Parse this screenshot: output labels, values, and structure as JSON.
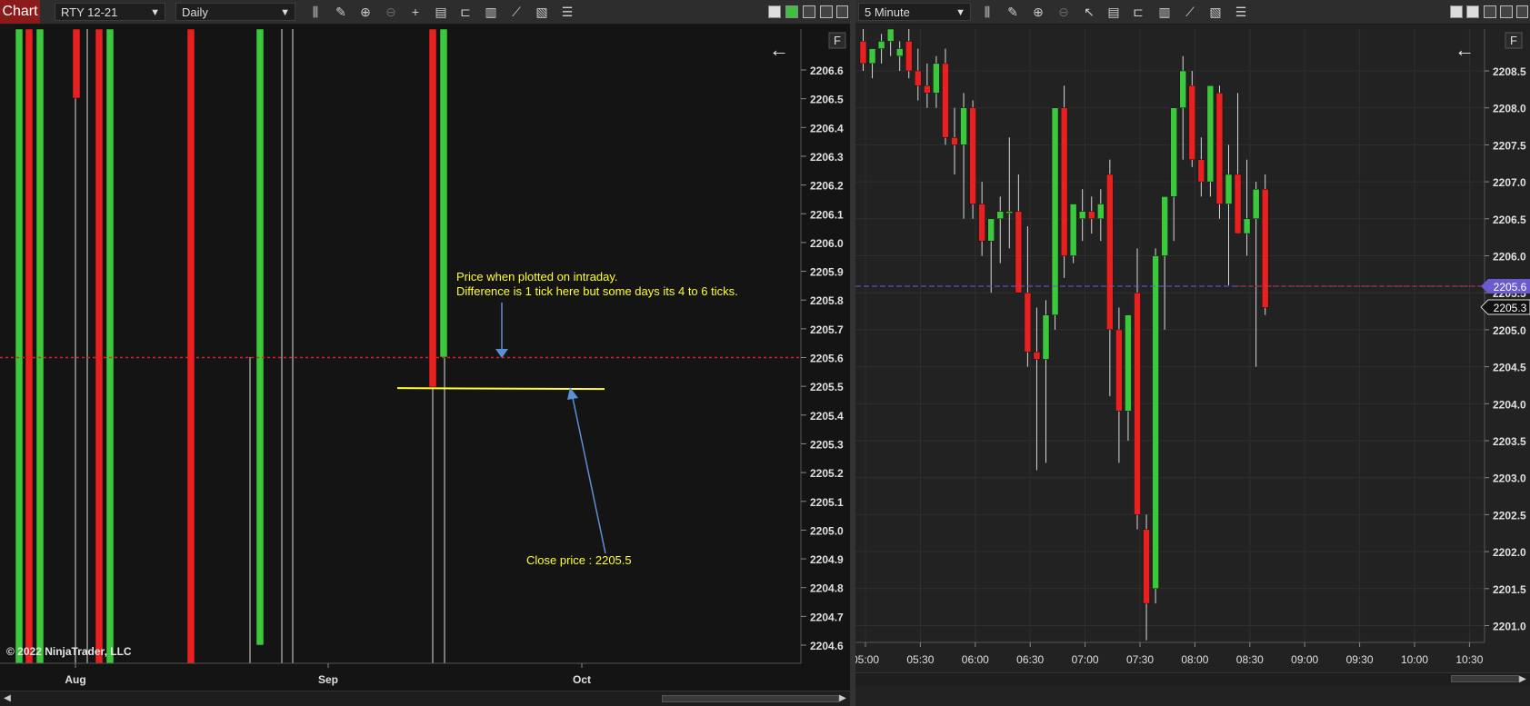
{
  "left": {
    "badge": "Chart",
    "instrument": "RTY 12-21",
    "interval": "Daily",
    "f_label": "F",
    "copyright": "© 2022 NinjaTrader, LLC",
    "annotation_line1": "Price when plotted on intraday.",
    "annotation_line2": "Difference is 1 tick here but some days its 4 to 6 ticks.",
    "close_label": "Close price : 2205.5",
    "y_ticks": [
      "2206.6",
      "2206.5",
      "2206.4",
      "2206.3",
      "2206.2",
      "2206.1",
      "2206.0",
      "2205.9",
      "2205.8",
      "2205.7",
      "2205.6",
      "2205.5",
      "2205.4",
      "2205.3",
      "2205.2",
      "2205.1",
      "2205.0",
      "2204.9",
      "2204.8",
      "2204.7",
      "2204.6"
    ],
    "x_ticks": [
      "Aug",
      "Sep",
      "Oct"
    ],
    "reference_price": 2205.6,
    "close_price": 2205.5
  },
  "right": {
    "interval": "5 Minute",
    "f_label": "F",
    "price_marker_current": "2205.6",
    "price_marker_close": "2205.3",
    "y_ticks": [
      "2208.5",
      "2208.0",
      "2207.5",
      "2207.0",
      "2206.5",
      "2206.0",
      "2205.5",
      "2205.0",
      "2204.5",
      "2204.0",
      "2203.5",
      "2203.0",
      "2202.5",
      "2202.0",
      "2201.5",
      "2201.0"
    ],
    "x_ticks": [
      "05:00",
      "05:30",
      "06:00",
      "06:30",
      "07:00",
      "07:30",
      "08:00",
      "08:30",
      "09:00",
      "09:30",
      "10:00",
      "10:30"
    ],
    "candles": [
      {
        "o": 2208.9,
        "h": 2209.2,
        "l": 2208.5,
        "c": 2208.6
      },
      {
        "o": 2208.6,
        "h": 2208.8,
        "l": 2208.4,
        "c": 2208.8
      },
      {
        "o": 2208.8,
        "h": 2209.0,
        "l": 2208.6,
        "c": 2208.9
      },
      {
        "o": 2208.9,
        "h": 2209.2,
        "l": 2208.7,
        "c": 2209.1
      },
      {
        "o": 2208.7,
        "h": 2208.9,
        "l": 2208.5,
        "c": 2208.8
      },
      {
        "o": 2208.9,
        "h": 2209.1,
        "l": 2208.4,
        "c": 2208.5
      },
      {
        "o": 2208.5,
        "h": 2208.8,
        "l": 2208.1,
        "c": 2208.3
      },
      {
        "o": 2208.3,
        "h": 2208.6,
        "l": 2208.0,
        "c": 2208.2
      },
      {
        "o": 2208.2,
        "h": 2208.7,
        "l": 2208.0,
        "c": 2208.6
      },
      {
        "o": 2208.6,
        "h": 2208.8,
        "l": 2207.5,
        "c": 2207.6
      },
      {
        "o": 2207.6,
        "h": 2208.0,
        "l": 2207.1,
        "c": 2207.5
      },
      {
        "o": 2207.5,
        "h": 2208.2,
        "l": 2206.5,
        "c": 2208.0
      },
      {
        "o": 2208.0,
        "h": 2208.1,
        "l": 2206.5,
        "c": 2206.7
      },
      {
        "o": 2206.7,
        "h": 2207.0,
        "l": 2206.0,
        "c": 2206.2
      },
      {
        "o": 2206.2,
        "h": 2206.5,
        "l": 2205.5,
        "c": 2206.5
      },
      {
        "o": 2206.5,
        "h": 2206.8,
        "l": 2205.9,
        "c": 2206.6
      },
      {
        "o": 2206.6,
        "h": 2207.6,
        "l": 2206.1,
        "c": 2206.6
      },
      {
        "o": 2206.6,
        "h": 2207.1,
        "l": 2205.6,
        "c": 2205.5
      },
      {
        "o": 2205.5,
        "h": 2206.4,
        "l": 2204.5,
        "c": 2204.7
      },
      {
        "o": 2204.7,
        "h": 2205.3,
        "l": 2203.1,
        "c": 2204.6
      },
      {
        "o": 2204.6,
        "h": 2205.4,
        "l": 2203.2,
        "c": 2205.2
      },
      {
        "o": 2205.2,
        "h": 2207.8,
        "l": 2205.0,
        "c": 2208.0
      },
      {
        "o": 2208.0,
        "h": 2208.3,
        "l": 2205.7,
        "c": 2206.0
      },
      {
        "o": 2206.0,
        "h": 2206.7,
        "l": 2205.9,
        "c": 2206.7
      },
      {
        "o": 2206.5,
        "h": 2206.9,
        "l": 2206.2,
        "c": 2206.6
      },
      {
        "o": 2206.6,
        "h": 2206.8,
        "l": 2206.3,
        "c": 2206.5
      },
      {
        "o": 2206.5,
        "h": 2206.9,
        "l": 2206.2,
        "c": 2206.7
      },
      {
        "o": 2207.1,
        "h": 2207.3,
        "l": 2204.1,
        "c": 2205.0
      },
      {
        "o": 2205.0,
        "h": 2205.3,
        "l": 2203.2,
        "c": 2203.9
      },
      {
        "o": 2203.9,
        "h": 2205.0,
        "l": 2203.5,
        "c": 2205.2
      },
      {
        "o": 2205.5,
        "h": 2206.1,
        "l": 2202.3,
        "c": 2202.5
      },
      {
        "o": 2202.3,
        "h": 2202.5,
        "l": 2200.8,
        "c": 2201.3
      },
      {
        "o": 2201.5,
        "h": 2206.1,
        "l": 2201.3,
        "c": 2206.0
      },
      {
        "o": 2206.0,
        "h": 2206.8,
        "l": 2205.0,
        "c": 2206.8
      },
      {
        "o": 2206.8,
        "h": 2207.8,
        "l": 2206.2,
        "c": 2208.0
      },
      {
        "o": 2208.0,
        "h": 2208.7,
        "l": 2207.3,
        "c": 2208.5
      },
      {
        "o": 2208.3,
        "h": 2208.5,
        "l": 2207.2,
        "c": 2207.3
      },
      {
        "o": 2207.3,
        "h": 2207.6,
        "l": 2206.8,
        "c": 2207.0
      },
      {
        "o": 2207.0,
        "h": 2208.0,
        "l": 2206.8,
        "c": 2208.3
      },
      {
        "o": 2208.2,
        "h": 2208.3,
        "l": 2206.5,
        "c": 2206.7
      },
      {
        "o": 2206.7,
        "h": 2207.5,
        "l": 2205.6,
        "c": 2207.1
      },
      {
        "o": 2207.1,
        "h": 2208.2,
        "l": 2206.3,
        "c": 2206.3
      },
      {
        "o": 2206.3,
        "h": 2207.3,
        "l": 2206.0,
        "c": 2206.5
      },
      {
        "o": 2206.5,
        "h": 2207.0,
        "l": 2204.5,
        "c": 2206.9
      },
      {
        "o": 2206.9,
        "h": 2207.1,
        "l": 2205.2,
        "c": 2205.3
      }
    ]
  },
  "colors": {
    "up": "#3cc83c",
    "down": "#e82020",
    "annotation": "#ffff33",
    "arrow": "#5b8fd8",
    "ref_line": "#e02020",
    "marker_current": "#6a5acd"
  }
}
